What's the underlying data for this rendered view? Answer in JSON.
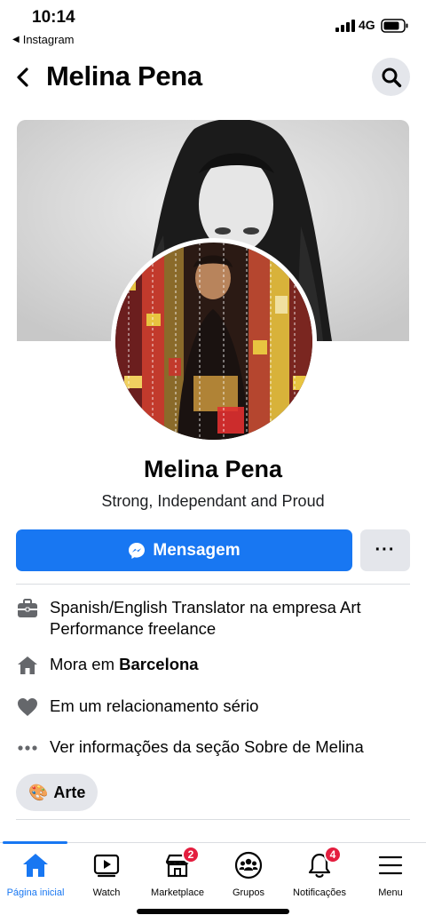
{
  "status_bar": {
    "time": "10:14",
    "back_app": "Instagram",
    "network": "4G"
  },
  "header": {
    "title": "Melina Pena"
  },
  "profile": {
    "name": "Melina Pena",
    "bio": "Strong, Independant and Proud"
  },
  "actions": {
    "message_label": "Mensagem",
    "more_label": "···"
  },
  "info": {
    "work": "Spanish/English Translator na empresa Art Performance freelance",
    "lives_prefix": "Mora em ",
    "lives_city": "Barcelona",
    "relationship": "Em um relacionamento sério",
    "see_about": "Ver informações da seção Sobre de Melina"
  },
  "interest_chip": {
    "emoji": "🎨",
    "label": "Arte"
  },
  "tab_bar": {
    "tabs": [
      {
        "label": "Página inicial",
        "icon": "home-icon"
      },
      {
        "label": "Watch",
        "icon": "watch-icon"
      },
      {
        "label": "Marketplace",
        "icon": "marketplace-icon",
        "badge": "2"
      },
      {
        "label": "Grupos",
        "icon": "groups-icon"
      },
      {
        "label": "Notificações",
        "icon": "bell-icon",
        "badge": "4"
      },
      {
        "label": "Menu",
        "icon": "menu-icon"
      }
    ]
  },
  "colors": {
    "accent": "#1877f2",
    "badge": "#e41e3f",
    "secondary_button": "#e4e6eb"
  }
}
